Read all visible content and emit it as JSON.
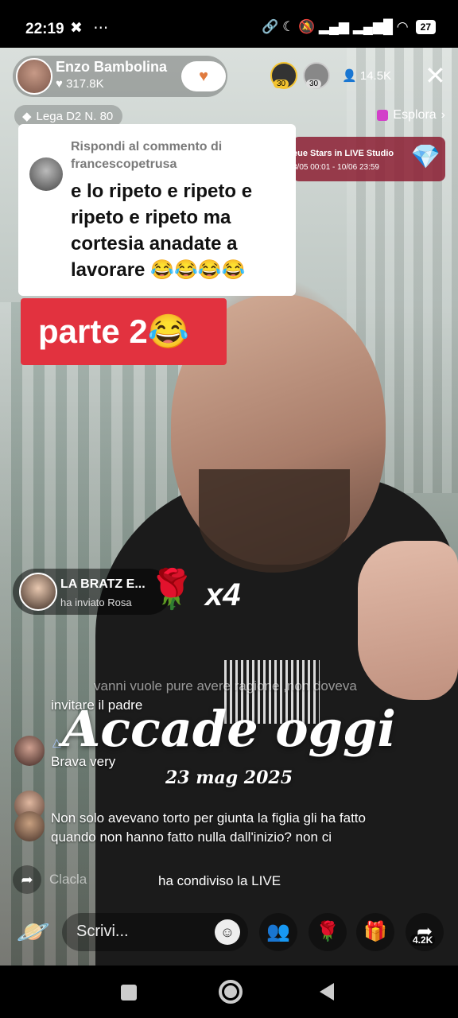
{
  "status_bar": {
    "time": "22:19",
    "left_icons": "✖ ⋯",
    "right_icons": "🔗 ☾ 🔕 ▂▄▆ ▂▄▆█ ◠",
    "battery": "27"
  },
  "live_header": {
    "host_name": "Enzo Bambolina",
    "host_likes": "♥ 317.8K",
    "follow_icon": "heart-plus-icon",
    "viewer_badge_1": "30",
    "viewer_badge_2": "30",
    "viewer_count": "14.5K",
    "close_label": "✕"
  },
  "league": {
    "label": "Lega D2 N. 80"
  },
  "explore": {
    "label": "Esplora",
    "chevron": "›"
  },
  "event_banner": {
    "title": "eue Stars in LIVE Studio",
    "dates": "3/05 00:01 - 10/06 23:59",
    "gem": "💎"
  },
  "reply_card": {
    "header": "Rispondi al commento di francescopetrusa",
    "body": "e lo ripeto e ripeto e ripeto e ripeto ma cortesia anadate a lavorare 😂😂😂😂"
  },
  "caption": {
    "text": "parte 2😂"
  },
  "gift": {
    "user": "LA BRATZ E...",
    "action": "ha inviato Rosa",
    "rose": "🌹",
    "count": "x4"
  },
  "comments": {
    "line1": "vanni vuole pure avere ragione ,non doveva",
    "line2": "invitare il  padre",
    "user_badge": "△",
    "line3": "Brava very",
    "line4": "Non solo avevano torto per giunta la figlia gli ha fatto",
    "line5": "quando non hanno fatto nulla dall'inizio? non ci"
  },
  "overlay": {
    "title": "Accade oggi",
    "date": "23 mag 2025"
  },
  "share_notice": {
    "icon": "➦",
    "user": "Clacla",
    "action": "ha condiviso la LIVE"
  },
  "bottom_bar": {
    "planet": "🪐",
    "input_placeholder": "Scrivi...",
    "emoji": "☺",
    "people": "👥",
    "rose": "🌹",
    "gift": "🎁",
    "share": "➦",
    "share_count": "4.2K"
  }
}
